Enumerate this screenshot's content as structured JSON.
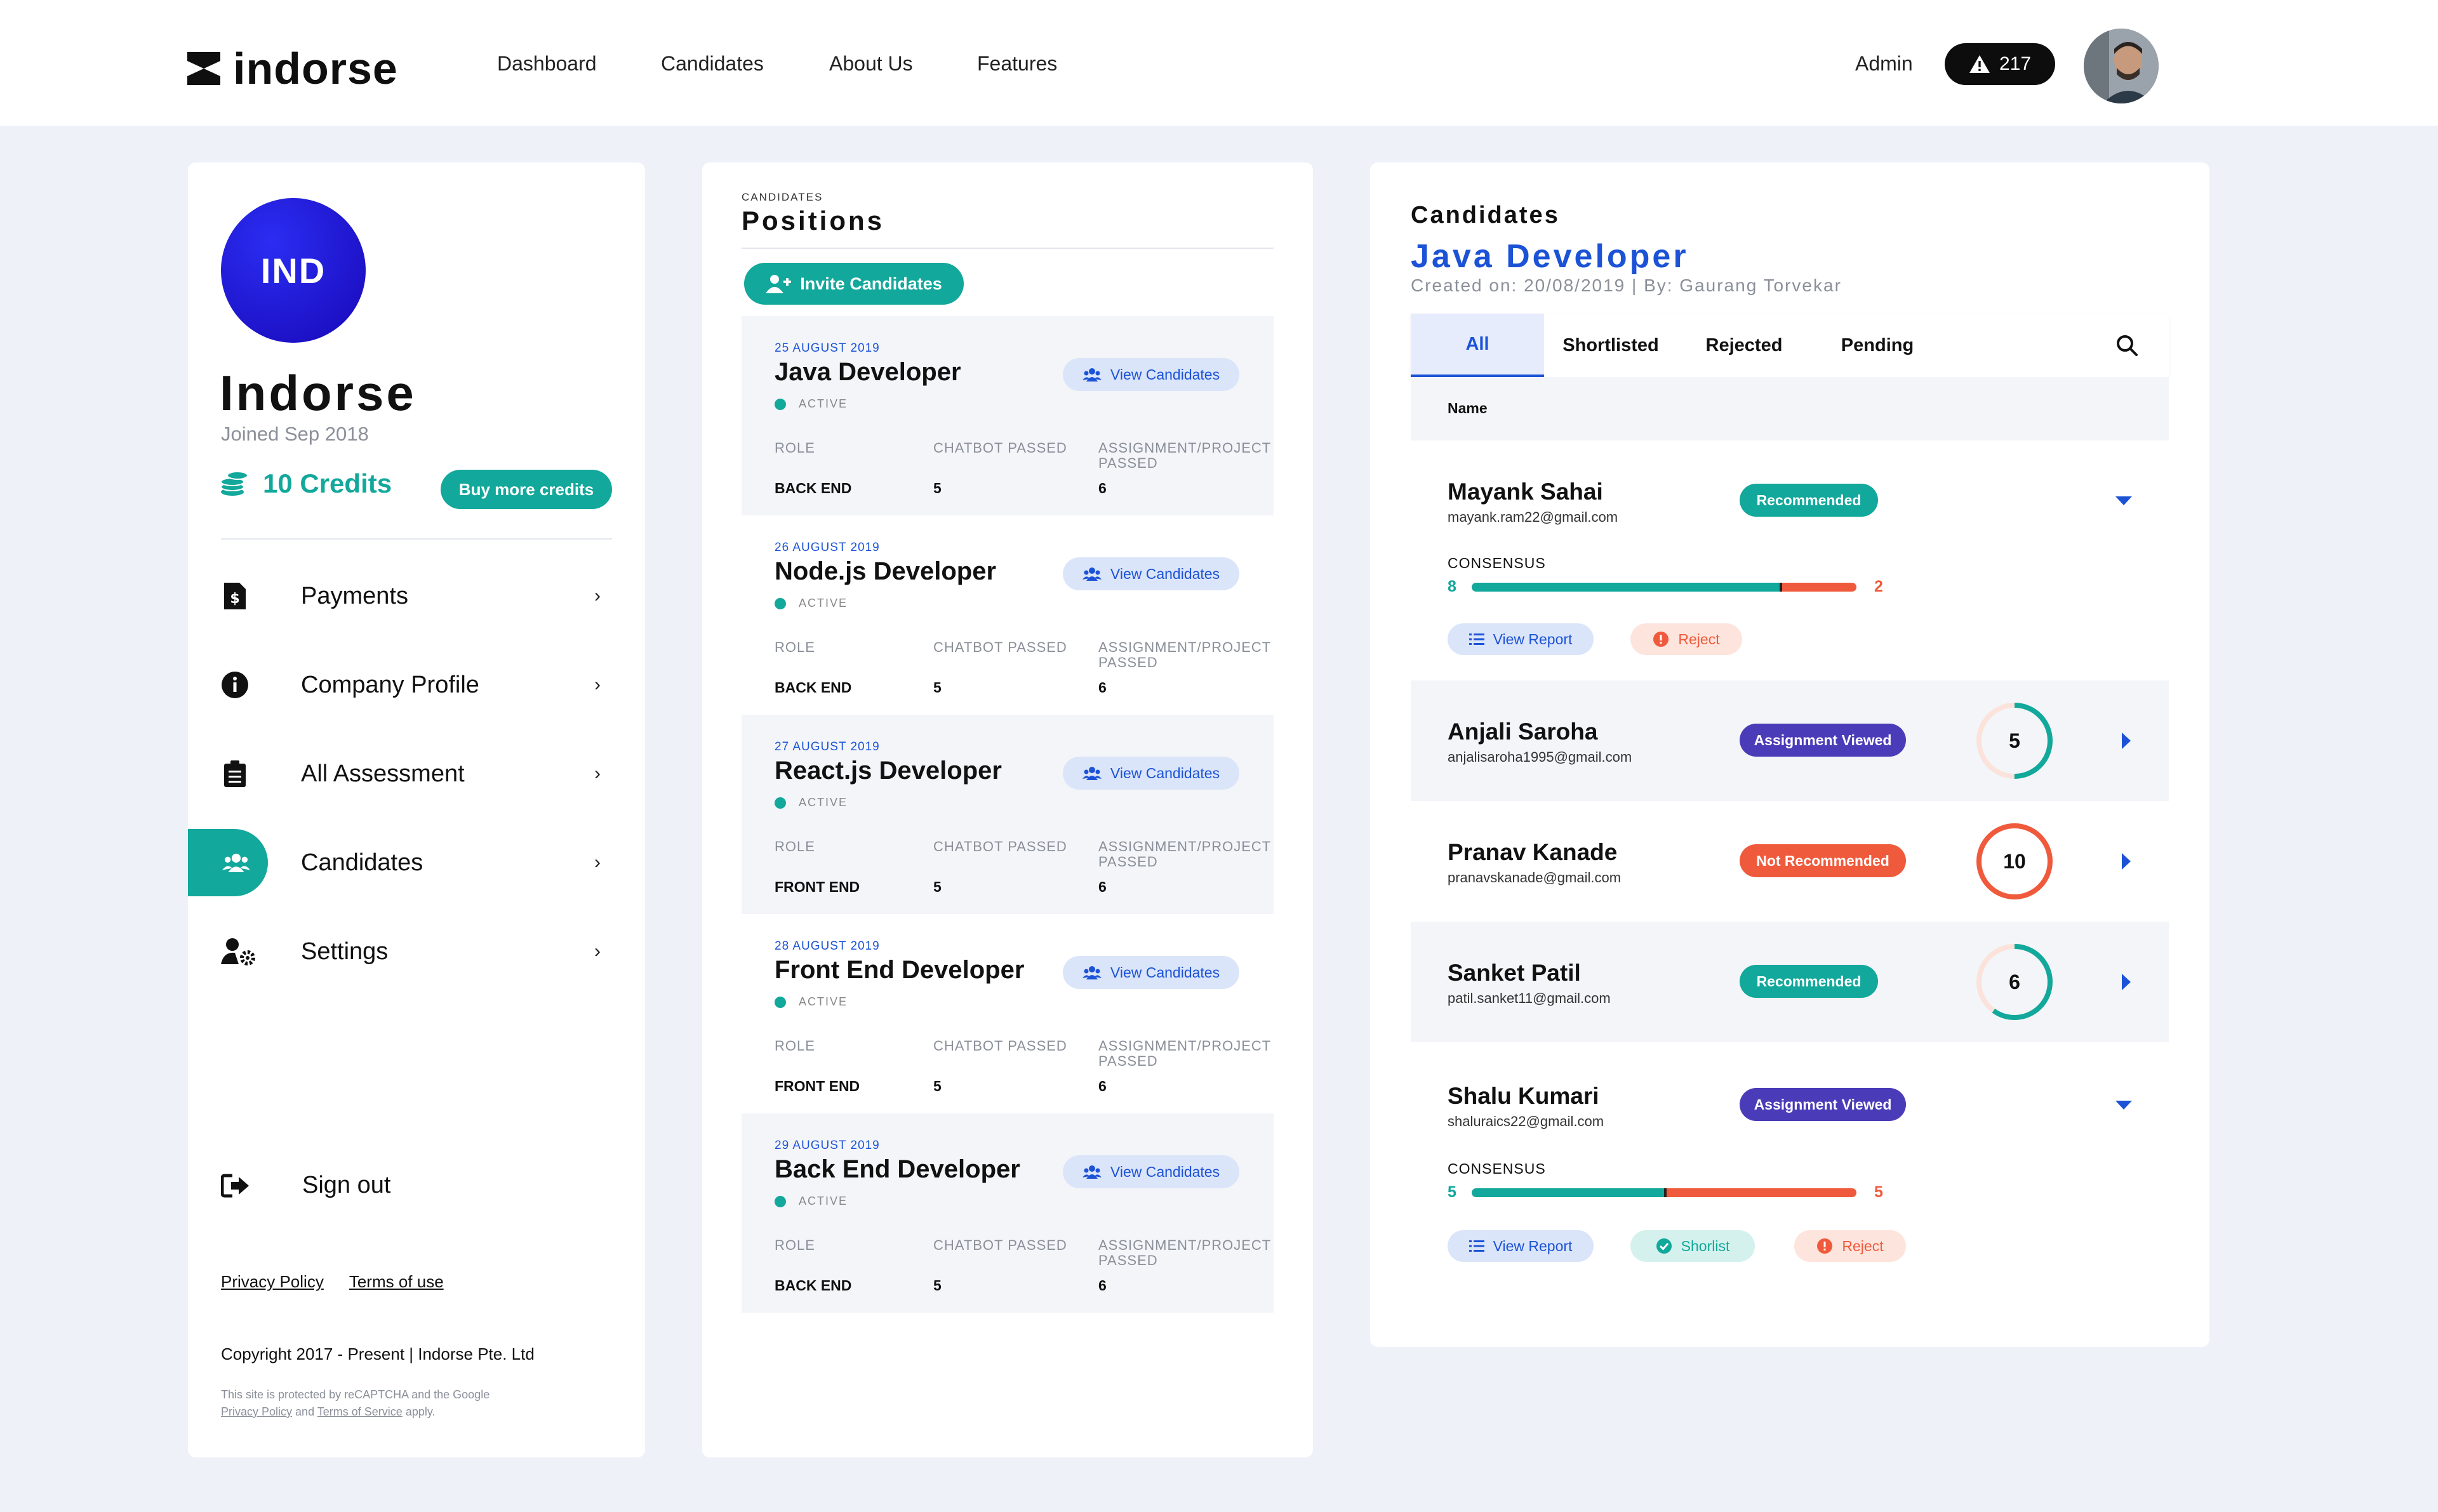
{
  "brand": {
    "name": "indorse"
  },
  "nav": {
    "links": [
      "Dashboard",
      "Candidates",
      "About Us",
      "Features"
    ],
    "admin": "Admin",
    "alerts": "217"
  },
  "profile": {
    "initials": "IND",
    "company": "Indorse",
    "joined": "Joined Sep 2018",
    "credits": "10 Credits",
    "buy_label": "Buy more credits"
  },
  "menu": [
    {
      "label": "Payments",
      "icon": "dollar-file-icon",
      "active": false
    },
    {
      "label": "Company Profile",
      "icon": "info-icon",
      "active": false
    },
    {
      "label": "All Assessment",
      "icon": "clipboard-icon",
      "active": false
    },
    {
      "label": "Candidates",
      "icon": "users-icon",
      "active": true
    },
    {
      "label": "Settings",
      "icon": "user-gear-icon",
      "active": false
    }
  ],
  "sign_out": "Sign out",
  "footer": {
    "privacy": "Privacy Policy",
    "terms": "Terms of use",
    "copyright": "Copyright 2017 - Present | Indorse Pte. Ltd",
    "recaptcha_1": "This site is protected by reCAPTCHA and the Google",
    "recaptcha_privacy": "Privacy Policy",
    "recaptcha_and": "and",
    "recaptcha_terms": "Terms of Service",
    "recaptcha_apply": "apply."
  },
  "positions": {
    "small_label": "CANDIDATES",
    "title": "Positions",
    "invite_label": "Invite Candidates",
    "view_label": "View Candidates",
    "status": "ACTIVE",
    "col_role": "ROLE",
    "col_chatbot": "CHATBOT PASSED",
    "col_assignment_1": "ASSIGNMENT/PROJECT",
    "col_assignment_2": "PASSED",
    "items": [
      {
        "date": "25 AUGUST 2019",
        "name": "Java Developer",
        "role": "BACK END",
        "chatbot": "5",
        "assignment": "6"
      },
      {
        "date": "26 AUGUST 2019",
        "name": "Node.js Developer",
        "role": "BACK END",
        "chatbot": "5",
        "assignment": "6"
      },
      {
        "date": "27 AUGUST 2019",
        "name": "React.js Developer",
        "role": "FRONT END",
        "chatbot": "5",
        "assignment": "6"
      },
      {
        "date": "28 AUGUST 2019",
        "name": "Front End Developer",
        "role": "FRONT END",
        "chatbot": "5",
        "assignment": "6"
      },
      {
        "date": "29 AUGUST 2019",
        "name": "Back End Developer",
        "role": "BACK END",
        "chatbot": "5",
        "assignment": "6"
      }
    ]
  },
  "detail": {
    "label": "Candidates",
    "job": "Java Developer",
    "created": "Created on: 20/08/2019 | By: Gaurang Torvekar",
    "tabs": [
      "All",
      "Shortlisted",
      "Rejected",
      "Pending"
    ],
    "name_header": "Name",
    "consensus_label": "CONSENSUS",
    "view_report": "View Report",
    "reject": "Reject",
    "shortlist": "Shorlist",
    "candidates": [
      {
        "name": "Mayank Sahai",
        "email": "mayank.ram22@gmail.com",
        "badge": "Recommended",
        "expanded": true,
        "yes": "8",
        "no": "2",
        "yes_fraction": 0.8
      },
      {
        "name": "Anjali Saroha",
        "email": "anjalisaroha1995@gmail.com",
        "badge": "Assignment Viewed",
        "expanded": false,
        "score": "5",
        "score_fraction": 0.5
      },
      {
        "name": "Pranav Kanade",
        "email": "pranavskanade@gmail.com",
        "badge": "Not Recommended",
        "expanded": false,
        "score": "10",
        "score_fraction": 1.0
      },
      {
        "name": "Sanket Patil",
        "email": "patil.sanket11@gmail.com",
        "badge": "Recommended",
        "expanded": false,
        "score": "6",
        "score_fraction": 0.6
      },
      {
        "name": "Shalu Kumari",
        "email": "shaluraics22@gmail.com",
        "badge": "Assignment Viewed",
        "expanded": true,
        "yes": "5",
        "no": "5",
        "yes_fraction": 0.5
      }
    ]
  },
  "colors": {
    "teal": "#12a89b",
    "blue": "#1c53d6",
    "red": "#f05a3c",
    "purple": "#4a3cb8"
  }
}
